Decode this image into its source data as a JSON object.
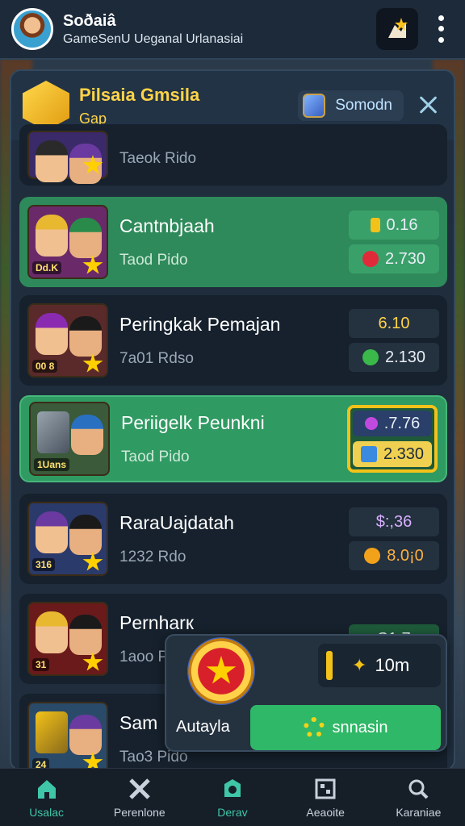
{
  "header": {
    "title": "Soðaiâ",
    "subtitle": "GameSenU Ueganal Urlanasiai"
  },
  "panel": {
    "title": "Pilsaia Gmsila",
    "subtitle": "Gap",
    "season_label": "Somodn"
  },
  "rows": [
    {
      "name": "",
      "meta": "Taeok Rido",
      "tag": "",
      "stat1": "",
      "stat2": "",
      "variant": "dark",
      "hair1": "#2a2a2a",
      "hair2": "#6a3aa0"
    },
    {
      "name": "Cantnbjaah",
      "meta": "Taod Pido",
      "tag": "Dd.K",
      "stat1": "0.16",
      "stat2": "2.730",
      "variant": "green",
      "hair1": "#e8b830",
      "hair2": "#2a8a4a"
    },
    {
      "name": "Peringkak Pemajan",
      "meta": "7a01 Rdso",
      "tag": "00 8",
      "stat1": "6.10",
      "stat2": "2.130",
      "variant": "dark",
      "hair1": "#8a2ab0",
      "hair2": "#1a1a1a"
    },
    {
      "name": "Periigelk Peunkni",
      "meta": "Taod Pido",
      "tag": "1Uans",
      "stat1": ".7.76",
      "stat2": "2.330",
      "variant": "highlight",
      "hair1": "#5a5a5a",
      "hair2": "#2a70c0"
    },
    {
      "name": "RaraUajdatah",
      "meta": "1232 Rdo",
      "tag": "316",
      "stat1": "$:,36",
      "stat2": "8.0¡0",
      "variant": "dark",
      "hair1": "#6a3aa0",
      "hair2": "#1a1a1a"
    },
    {
      "name": "Pernharк",
      "meta": "1aoo Pdo",
      "tag": "31",
      "stat1": "S1.7",
      "stat2": "",
      "variant": "dark",
      "hair1": "#e8b830",
      "hair2": "#1a1a1a"
    },
    {
      "name": "Sam",
      "meta": "Tao3 Pido",
      "tag": "24",
      "stat1": "",
      "stat2": "",
      "variant": "dark",
      "hair1": "#5a5a5a",
      "hair2": "#6a3aa0"
    }
  ],
  "reward": {
    "timer": "10m",
    "label": "Autayla",
    "button_label": "snnasin"
  },
  "nav": [
    {
      "label": "Usalac",
      "icon": "home-icon"
    },
    {
      "label": "Perenlone",
      "icon": "crossed-swords-icon"
    },
    {
      "label": "Derav",
      "icon": "shield-badge-icon"
    },
    {
      "label": "Aeaoite",
      "icon": "grid-icon"
    },
    {
      "label": "Karaniae",
      "icon": "search-icon"
    }
  ],
  "colors": {
    "accent_green": "#2fb867",
    "gold": "#f2c21a",
    "active_nav": "#3fc6a8"
  }
}
